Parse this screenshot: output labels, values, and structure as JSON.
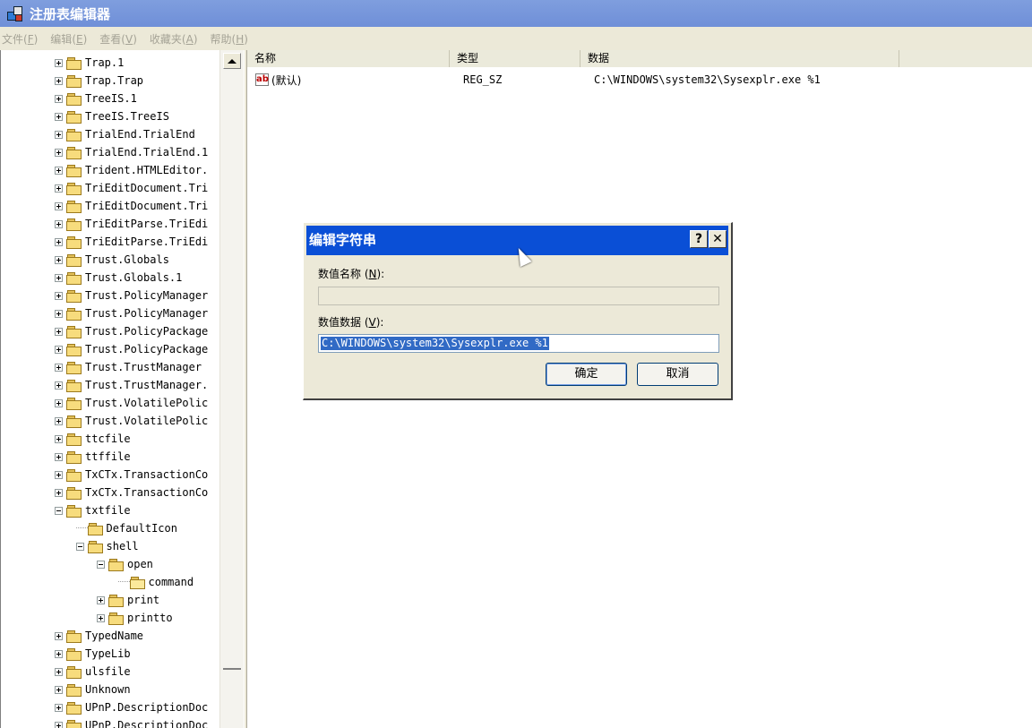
{
  "window": {
    "title": "注册表编辑器"
  },
  "menu": [
    {
      "label": "文件",
      "key": "F"
    },
    {
      "label": "编辑",
      "key": "E"
    },
    {
      "label": "查看",
      "key": "V"
    },
    {
      "label": "收藏夹",
      "key": "A"
    },
    {
      "label": "帮助",
      "key": "H"
    }
  ],
  "tree": [
    {
      "label": "Trap.1",
      "level": 0,
      "state": "plus"
    },
    {
      "label": "Trap.Trap",
      "level": 0,
      "state": "plus"
    },
    {
      "label": "TreeIS.1",
      "level": 0,
      "state": "plus"
    },
    {
      "label": "TreeIS.TreeIS",
      "level": 0,
      "state": "plus"
    },
    {
      "label": "TrialEnd.TrialEnd",
      "level": 0,
      "state": "plus"
    },
    {
      "label": "TrialEnd.TrialEnd.1",
      "level": 0,
      "state": "plus"
    },
    {
      "label": "Trident.HTMLEditor.",
      "level": 0,
      "state": "plus"
    },
    {
      "label": "TriEditDocument.Tri",
      "level": 0,
      "state": "plus"
    },
    {
      "label": "TriEditDocument.Tri",
      "level": 0,
      "state": "plus"
    },
    {
      "label": "TriEditParse.TriEdi",
      "level": 0,
      "state": "plus"
    },
    {
      "label": "TriEditParse.TriEdi",
      "level": 0,
      "state": "plus"
    },
    {
      "label": "Trust.Globals",
      "level": 0,
      "state": "plus"
    },
    {
      "label": "Trust.Globals.1",
      "level": 0,
      "state": "plus"
    },
    {
      "label": "Trust.PolicyManager",
      "level": 0,
      "state": "plus"
    },
    {
      "label": "Trust.PolicyManager",
      "level": 0,
      "state": "plus"
    },
    {
      "label": "Trust.PolicyPackage",
      "level": 0,
      "state": "plus"
    },
    {
      "label": "Trust.PolicyPackage",
      "level": 0,
      "state": "plus"
    },
    {
      "label": "Trust.TrustManager",
      "level": 0,
      "state": "plus"
    },
    {
      "label": "Trust.TrustManager.",
      "level": 0,
      "state": "plus"
    },
    {
      "label": "Trust.VolatilePolic",
      "level": 0,
      "state": "plus"
    },
    {
      "label": "Trust.VolatilePolic",
      "level": 0,
      "state": "plus"
    },
    {
      "label": "ttcfile",
      "level": 0,
      "state": "plus"
    },
    {
      "label": "ttffile",
      "level": 0,
      "state": "plus"
    },
    {
      "label": "TxCTx.TransactionCo",
      "level": 0,
      "state": "plus"
    },
    {
      "label": "TxCTx.TransactionCo",
      "level": 0,
      "state": "plus"
    },
    {
      "label": "txtfile",
      "level": 0,
      "state": "minus"
    },
    {
      "label": "DefaultIcon",
      "level": 1,
      "state": "none"
    },
    {
      "label": "shell",
      "level": 1,
      "state": "minus"
    },
    {
      "label": "open",
      "level": 2,
      "state": "minus"
    },
    {
      "label": "command",
      "level": 3,
      "state": "none",
      "open": true
    },
    {
      "label": "print",
      "level": 2,
      "state": "plus"
    },
    {
      "label": "printto",
      "level": 2,
      "state": "plus"
    },
    {
      "label": "TypedName",
      "level": 0,
      "state": "plus"
    },
    {
      "label": "TypeLib",
      "level": 0,
      "state": "plus"
    },
    {
      "label": "ulsfile",
      "level": 0,
      "state": "plus"
    },
    {
      "label": "Unknown",
      "level": 0,
      "state": "plus"
    },
    {
      "label": "UPnP.DescriptionDoc",
      "level": 0,
      "state": "plus"
    },
    {
      "label": "UPnP.DescriptionDoc",
      "level": 0,
      "state": "plus"
    }
  ],
  "list": {
    "columns": [
      "名称",
      "类型",
      "数据"
    ],
    "rows": [
      {
        "name": "(默认)",
        "type": "REG_SZ",
        "data": "C:\\WINDOWS\\system32\\Sysexplr.exe %1"
      }
    ]
  },
  "dialog": {
    "title": "编辑字符串",
    "help_btn": "?",
    "close_btn": "✕",
    "name_label": "数值名称",
    "name_key": "N",
    "name_value": "",
    "data_label": "数值数据",
    "data_key": "V",
    "data_value": "C:\\WINDOWS\\system32\\Sysexplr.exe %1",
    "ok_label": "确定",
    "cancel_label": "取消"
  }
}
